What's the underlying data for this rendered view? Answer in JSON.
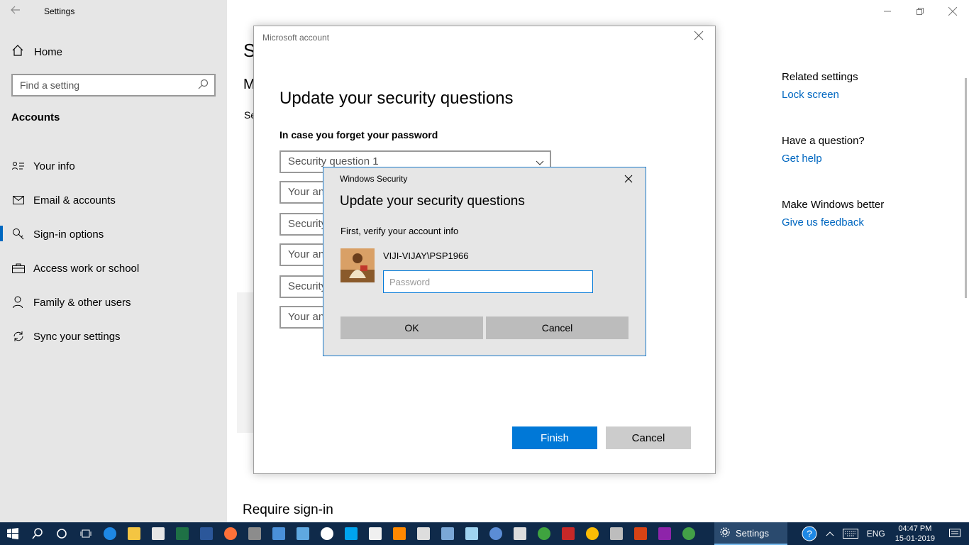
{
  "app": {
    "title": "Settings"
  },
  "sidebar": {
    "home_label": "Home",
    "search_placeholder": "Find a setting",
    "section": "Accounts",
    "items": [
      {
        "label": "Your info",
        "icon": "person-card-icon"
      },
      {
        "label": "Email & accounts",
        "icon": "mail-icon"
      },
      {
        "label": "Sign-in options",
        "icon": "key-icon",
        "selected": true
      },
      {
        "label": "Access work or school",
        "icon": "briefcase-icon"
      },
      {
        "label": "Family & other users",
        "icon": "person-add-icon"
      },
      {
        "label": "Sync your settings",
        "icon": "sync-icon"
      }
    ]
  },
  "background": {
    "frag_s": "S",
    "frag_m": "M",
    "frag_se": "Se",
    "require_signin": "Require sign-in"
  },
  "related": {
    "related_header": "Related settings",
    "lock_screen": "Lock screen",
    "question_header": "Have a question?",
    "get_help": "Get help",
    "better_header": "Make Windows better",
    "feedback": "Give us feedback"
  },
  "ms_dialog": {
    "title": "Microsoft account",
    "heading": "Update your security questions",
    "subheading": "In case you forget your password",
    "select1": "Security question 1",
    "answer": "Your an",
    "security": "Security",
    "finish": "Finish",
    "cancel": "Cancel"
  },
  "ws_dialog": {
    "title": "Windows Security",
    "heading": "Update your security questions",
    "subtitle": "First, verify your account info",
    "username": "VIJI-VIJAY\\PSP1966",
    "password_placeholder": "Password",
    "ok": "OK",
    "cancel": "Cancel"
  },
  "taskbar": {
    "active_app": "Settings",
    "language": "ENG",
    "time": "04:47 PM",
    "date": "15-01-2019"
  },
  "colors": {
    "accent": "#0078d7",
    "link": "#0067c0",
    "taskbar": "#0f2a4a"
  }
}
